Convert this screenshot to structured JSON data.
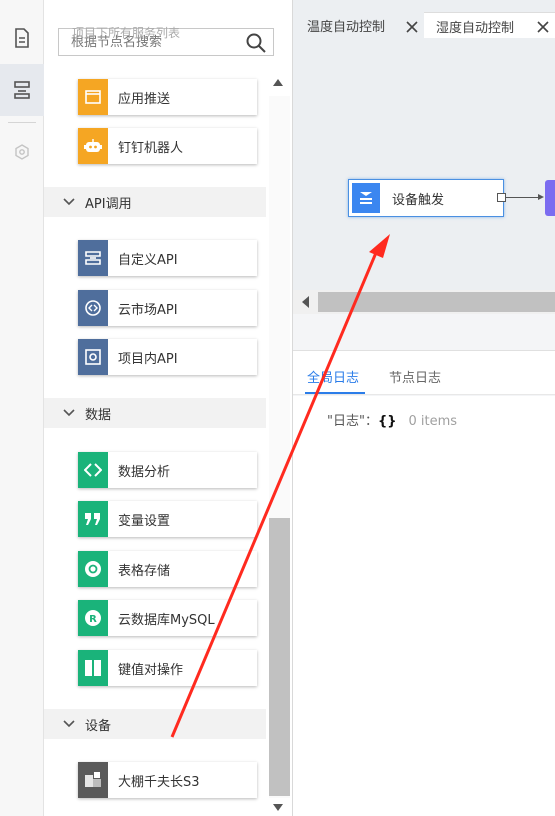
{
  "search": {
    "ghost_text": "项目下所有服务列表",
    "placeholder": "根据节点名搜索"
  },
  "palette": {
    "top_nodes": [
      {
        "label": "应用推送",
        "icon": "app-push-icon",
        "color": "#f5a623"
      },
      {
        "label": "钉钉机器人",
        "icon": "robot-icon",
        "color": "#f5a623"
      }
    ],
    "categories": [
      {
        "label": "API调用",
        "nodes": [
          {
            "label": "自定义API",
            "icon": "custom-api-icon",
            "color": "#4f6e9c"
          },
          {
            "label": "云市场API",
            "icon": "market-api-icon",
            "color": "#4f6e9c"
          },
          {
            "label": "项目内API",
            "icon": "project-api-icon",
            "color": "#4f6e9c"
          }
        ]
      },
      {
        "label": "数据",
        "nodes": [
          {
            "label": "数据分析",
            "icon": "code-icon",
            "color": "#1ab37a"
          },
          {
            "label": "变量设置",
            "icon": "quote-icon",
            "color": "#1ab37a"
          },
          {
            "label": "表格存储",
            "icon": "table-store-icon",
            "color": "#1ab37a"
          },
          {
            "label": "云数据库MySQL",
            "icon": "mysql-icon",
            "color": "#1ab37a"
          },
          {
            "label": "键值对操作",
            "icon": "key-value-icon",
            "color": "#1ab37a"
          }
        ]
      },
      {
        "label": "设备",
        "nodes": [
          {
            "label": "大棚千夫长S3",
            "icon": "device-icon",
            "color": "#5a5a5a"
          }
        ]
      }
    ]
  },
  "tabs": [
    {
      "label": "温度自动控制",
      "active": false
    },
    {
      "label": "湿度自动控制",
      "active": true
    }
  ],
  "canvas": {
    "node_label": "设备触发"
  },
  "log_tabs": [
    {
      "label": "全局日志",
      "active": true
    },
    {
      "label": "节点日志",
      "active": false
    }
  ],
  "log": {
    "key": "\"日志\"",
    "colon": "：",
    "brace": "{}",
    "count": "0 items"
  },
  "colors": {
    "accent": "#2b7de9",
    "annotation_arrow": "#ff2a1f"
  }
}
